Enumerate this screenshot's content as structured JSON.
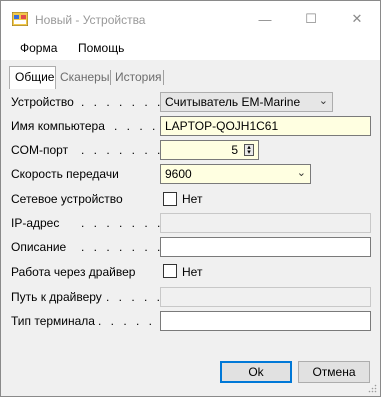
{
  "window": {
    "title": "Новый - Устройства",
    "minimize_glyph": "—",
    "maximize_glyph": "☐",
    "close_glyph": "✕"
  },
  "menu": {
    "items": [
      {
        "label": "Форма"
      },
      {
        "label": "Помощь"
      }
    ]
  },
  "tabs": [
    {
      "label": "Общие",
      "active": true
    },
    {
      "label": "Сканеры",
      "active": false
    },
    {
      "label": "История",
      "active": false
    }
  ],
  "form": {
    "device": {
      "label": "Устройство",
      "value": "Считыватель EM-Marine"
    },
    "computer_name": {
      "label": "Имя компьютера",
      "value": "LAPTOP-QOJH1C61"
    },
    "com_port": {
      "label": "COM-порт",
      "value": "5"
    },
    "baud_rate": {
      "label": "Скорость передачи",
      "value": "9600"
    },
    "network_device": {
      "label": "Сетевое устройство",
      "checkbox_label": "Нет",
      "checked": false
    },
    "ip_address": {
      "label": "IP-адрес",
      "value": ""
    },
    "description": {
      "label": "Описание",
      "value": ""
    },
    "via_driver": {
      "label": "Работа через драйвер",
      "checkbox_label": "Нет",
      "checked": false
    },
    "driver_path": {
      "label": "Путь к драйверу",
      "value": ""
    },
    "terminal_type": {
      "label": "Тип терминала",
      "value": ""
    }
  },
  "buttons": {
    "ok": "Ok",
    "cancel": "Отмена"
  },
  "dots": ". . . . . . . . . . . .",
  "icons": {
    "app": "app-window-icon",
    "dropdown": "chevron-down-icon",
    "spin": "spin-updown-icon",
    "grip": "resize-grip-icon"
  }
}
